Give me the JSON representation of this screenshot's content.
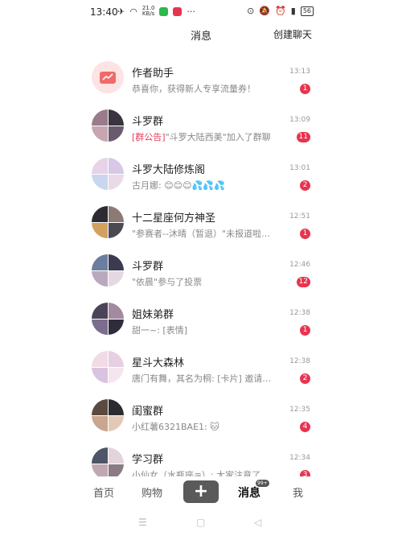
{
  "status_bar": {
    "time": "13:40",
    "net_speed_top": "21.0",
    "net_speed_bottom": "KB/s",
    "battery": "56",
    "more": "···"
  },
  "header": {
    "title": "消息",
    "create_chat": "创建聊天"
  },
  "chats": [
    {
      "name": "作者助手",
      "preview": "恭喜你，获得新人专享流量券！",
      "time": "13:13",
      "unread": "1",
      "avatar_colors": [
        "#fde3e3"
      ]
    },
    {
      "name": "斗罗群",
      "notice_tag": "[群公告]",
      "preview": "\"斗罗大陆西美\"加入了群聊",
      "time": "13:09",
      "unread": "11",
      "avatar_colors": [
        "#9a7b8c",
        "#3a3440",
        "#c7a6b0",
        "#6a5a6e"
      ]
    },
    {
      "name": "斗罗大陆修炼阁",
      "preview": "古月娜: 😊😊😊💦💦💦",
      "time": "13:01",
      "unread": "2",
      "avatar_colors": [
        "#e7d3e8",
        "#d8c7e6",
        "#c9d6ee",
        "#ead9e6"
      ]
    },
    {
      "name": "十二星座何方神圣",
      "preview": "\"参赛者--沐晴（暂退）\"未报道啦…",
      "time": "12:51",
      "unread": "1",
      "avatar_colors": [
        "#2d2a34",
        "#8b7b74",
        "#d3a15f",
        "#4b4a52"
      ]
    },
    {
      "name": "斗罗群",
      "preview": "\"依晨\"参与了投票",
      "time": "12:46",
      "unread": "12",
      "avatar_colors": [
        "#6c7ea0",
        "#3b3a4f",
        "#b9a9be",
        "#e4d9e3"
      ]
    },
    {
      "name": "姐妹弟群",
      "preview": "甜一~: [表情]",
      "time": "12:38",
      "unread": "1",
      "avatar_colors": [
        "#4a4458",
        "#a28aa0",
        "#7b6d8e",
        "#2f2c3b"
      ]
    },
    {
      "name": "星斗大森林",
      "preview": "唐门有舞，其名为桐: [卡片] 邀请你…",
      "time": "12:38",
      "unread": "2",
      "avatar_colors": [
        "#f1dbe7",
        "#e6cfe3",
        "#d9c4e0",
        "#f4e5ee"
      ]
    },
    {
      "name": "闺蜜群",
      "preview": "小红薯6321BAE1: 🐱",
      "time": "12:35",
      "unread": "4",
      "avatar_colors": [
        "#5b4a3f",
        "#2c2b30",
        "#c9a68f",
        "#e2c9b6"
      ]
    },
    {
      "name": "学习群",
      "preview": "小仙女（水瓶座♒）: 大家注意了…",
      "time": "12:34",
      "unread": "3",
      "avatar_colors": [
        "#4e5566",
        "#e3d3da",
        "#bfa8b2",
        "#8a7b86"
      ]
    }
  ],
  "tabbar": {
    "home": "首页",
    "shop": "购物",
    "plus": "+",
    "messages": "消息",
    "messages_badge": "99+",
    "me": "我"
  },
  "navbar": {
    "menu": "☰",
    "home": "▢",
    "back": "◁"
  }
}
